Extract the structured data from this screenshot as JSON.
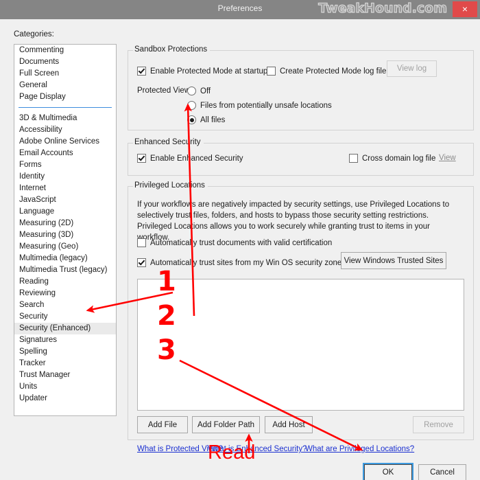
{
  "window": {
    "title": "Preferences",
    "watermark": "TweakHound.com",
    "close_label": "×",
    "titlebar_color": "#858585",
    "close_color": "#e04a4a",
    "body_color": "#f0f0f0",
    "accent_link_color": "#1a2fd0",
    "annotation_color": "#ff0000"
  },
  "sidebar": {
    "label": "Categories:",
    "selected": "Security (Enhanced)",
    "group_one": [
      "Commenting",
      "Documents",
      "Full Screen",
      "General",
      "Page Display"
    ],
    "group_two": [
      "3D & Multimedia",
      "Accessibility",
      "Adobe Online Services",
      "Email Accounts",
      "Forms",
      "Identity",
      "Internet",
      "JavaScript",
      "Language",
      "Measuring (2D)",
      "Measuring (3D)",
      "Measuring (Geo)",
      "Multimedia (legacy)",
      "Multimedia Trust (legacy)",
      "Reading",
      "Reviewing",
      "Search",
      "Security",
      "Security (Enhanced)",
      "Signatures",
      "Spelling",
      "Tracker",
      "Trust Manager",
      "Units",
      "Updater"
    ]
  },
  "sandbox": {
    "title": "Sandbox Protections",
    "enable_protected_mode": {
      "label": "Enable Protected Mode at startup",
      "checked": true
    },
    "create_log_file": {
      "label": "Create Protected Mode log file",
      "checked": false
    },
    "view_log_button": {
      "label": "View log",
      "enabled": false
    },
    "protected_view_label": "Protected View",
    "protected_view_options": [
      {
        "label": "Off",
        "selected": false
      },
      {
        "label": "Files from potentially unsafe locations",
        "selected": false
      },
      {
        "label": "All files",
        "selected": true
      }
    ]
  },
  "enhanced_security": {
    "title": "Enhanced Security",
    "enable": {
      "label": "Enable Enhanced Security",
      "checked": true
    },
    "cross_domain_log": {
      "label": "Cross domain log file",
      "checked": false
    },
    "view_link": "View"
  },
  "privileged_locations": {
    "title": "Privileged Locations",
    "description": "If your workflows are negatively impacted by security settings, use Privileged Locations to selectively trust files, folders, and hosts to bypass those security setting restrictions. Privileged Locations allows you to work securely while granting trust to items in your workflow.",
    "trust_documents": {
      "label": "Automatically trust documents with valid certification",
      "checked": false
    },
    "trust_sites": {
      "label": "Automatically trust sites from my Win OS security zones",
      "checked": true
    },
    "view_trusted_sites_button": "View Windows Trusted Sites",
    "list_items": [],
    "buttons": {
      "add_file": "Add File",
      "add_folder_path": "Add Folder Path",
      "add_host": "Add Host",
      "remove": "Remove",
      "remove_enabled": false
    }
  },
  "help_links": [
    "What is Protected View?",
    "What is Enhanced Security?",
    "What are Privileged Locations?"
  ],
  "dialog_buttons": {
    "ok": "OK",
    "cancel": "Cancel",
    "ok_focused": true
  },
  "annotations": {
    "numbers": [
      "1",
      "2",
      "3"
    ],
    "read_label": "Read"
  }
}
